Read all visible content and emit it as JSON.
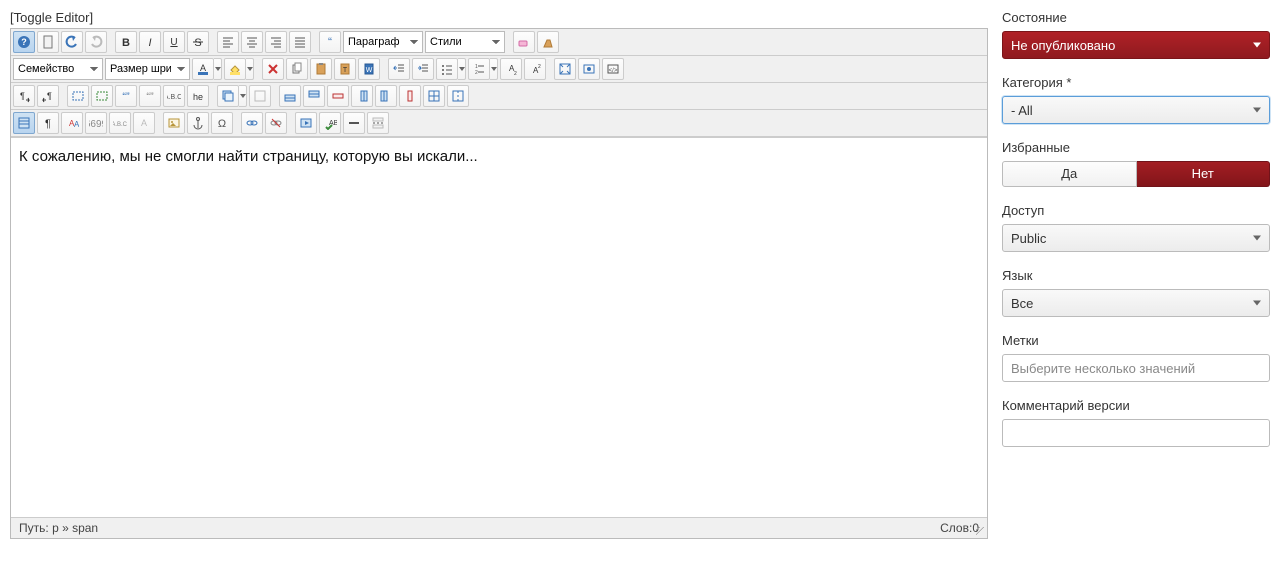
{
  "toggle_editor": "[Toggle Editor]",
  "toolbar": {
    "format_select": "Параграф",
    "style_select": "Стили",
    "font_family": "Семейство",
    "font_size": "Размер шриф"
  },
  "editor": {
    "content": "К сожалению, мы не смогли найти страницу, которую вы искали..."
  },
  "status": {
    "path_label": "Путь:",
    "path_value": "p » span",
    "words_label": "Слов:",
    "words_value": "0"
  },
  "sidebar": {
    "state": {
      "label": "Состояние",
      "value": "Не опубликовано"
    },
    "category": {
      "label": "Категория *",
      "value": "- All"
    },
    "featured": {
      "label": "Избранные",
      "yes": "Да",
      "no": "Нет"
    },
    "access": {
      "label": "Доступ",
      "value": "Public"
    },
    "language": {
      "label": "Язык",
      "value": "Все"
    },
    "tags": {
      "label": "Метки",
      "placeholder": "Выберите несколько значений"
    },
    "version_note": {
      "label": "Комментарий версии"
    }
  }
}
